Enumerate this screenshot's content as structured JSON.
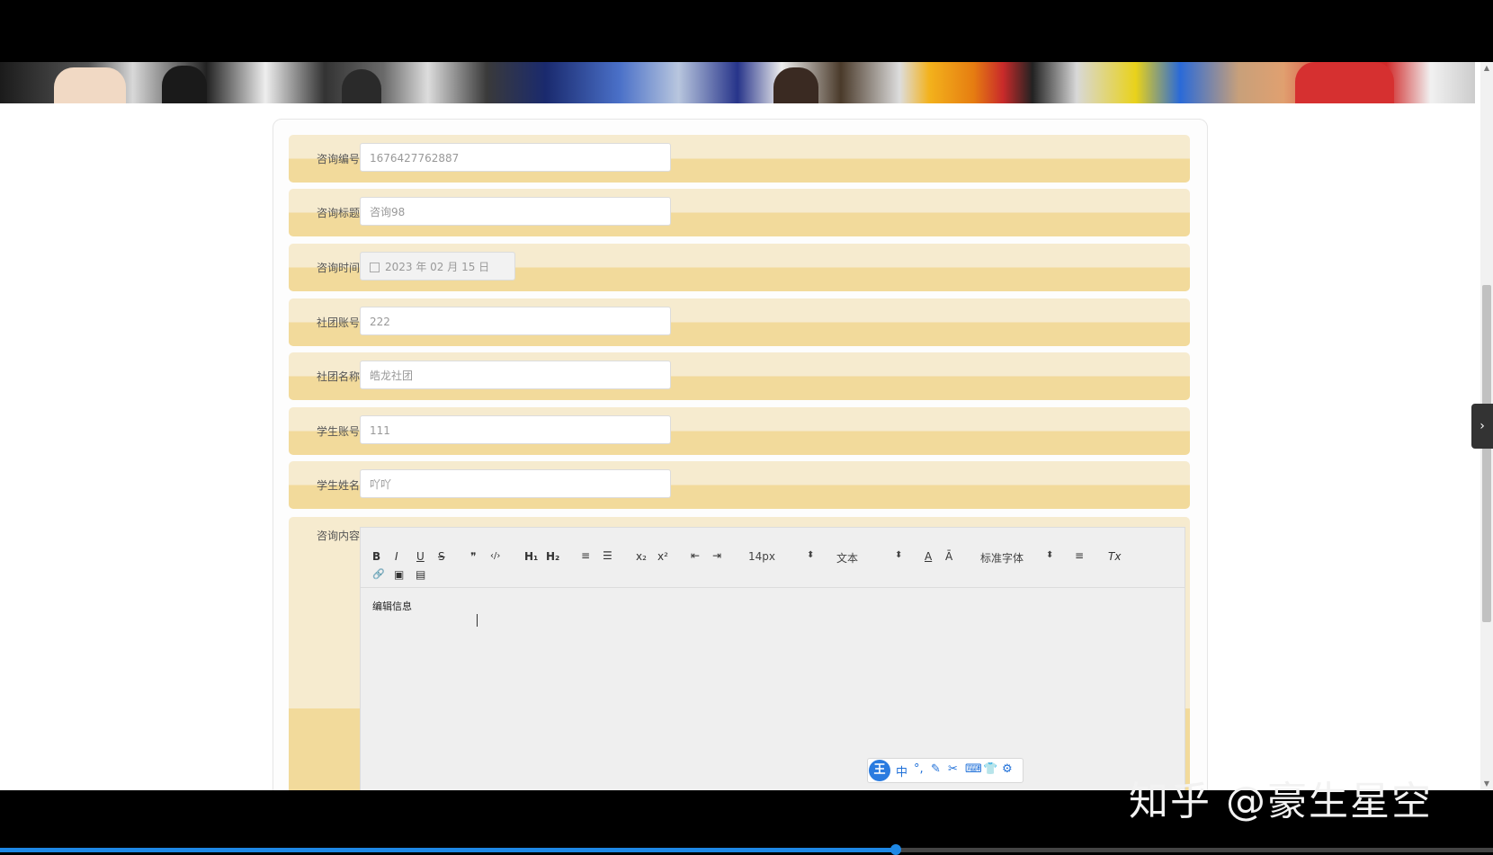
{
  "form": {
    "fields": [
      {
        "label": "咨询编号",
        "value": "1676427762887"
      },
      {
        "label": "咨询标题",
        "value": "咨询98"
      },
      {
        "label": "咨询时间",
        "value": "2023 年 02 月 15 日"
      },
      {
        "label": "社团账号",
        "value": "222"
      },
      {
        "label": "社团名称",
        "value": "皓龙社团"
      },
      {
        "label": "学生账号",
        "value": "111"
      },
      {
        "label": "学生姓名",
        "value": "吖吖"
      }
    ],
    "content_label": "咨询内容"
  },
  "editor": {
    "toolbar": {
      "bold": "B",
      "italic": "I",
      "underline": "U",
      "strike": "S",
      "quote": "❞",
      "code": "‹/›",
      "h1": "H₁",
      "h2": "H₂",
      "ordered_list": "≡",
      "bullet_list": "☰",
      "subscript": "x₂",
      "superscript": "x²",
      "outdent": "⇤",
      "indent": "⇥",
      "size_value": "14px",
      "header_value": "文本",
      "font_value": "标准字体",
      "color": "A",
      "background": "Ā",
      "align": "≡",
      "clean": "Tx",
      "link": "🔗",
      "image": "▣",
      "video": "▤",
      "select_arrow": "⬍"
    },
    "content_text": "编辑信息"
  },
  "ime": {
    "logo": "王",
    "icons": [
      "中",
      "°,",
      "✎",
      "✂",
      "⌨",
      "👕",
      "⚙"
    ]
  },
  "watermark": "知乎 @豪生星空",
  "scrollbar": {
    "up": "▲",
    "down": "▼"
  },
  "side_toggle": "›",
  "video_progress": 0.6
}
